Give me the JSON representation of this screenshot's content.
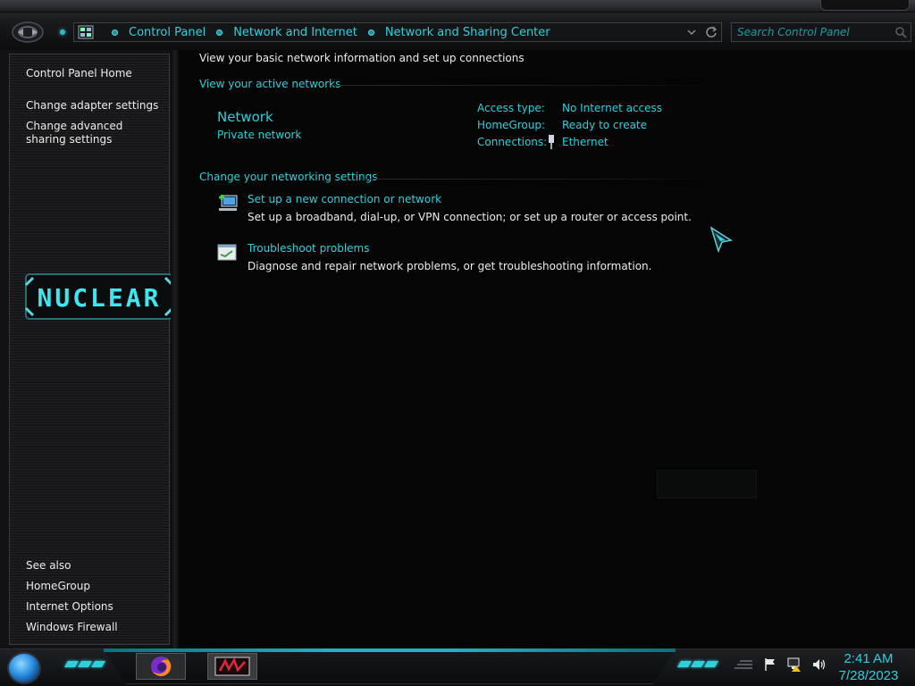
{
  "address_bar": {
    "crumbs": [
      "Control Panel",
      "Network and Internet",
      "Network and Sharing Center"
    ]
  },
  "search": {
    "placeholder": "Search Control Panel"
  },
  "sidebar": {
    "home": "Control Panel Home",
    "links": [
      "Change adapter settings",
      "Change advanced sharing settings"
    ],
    "logo_text": "NUCLEAR",
    "see_also_heading": "See also",
    "see_also": [
      "HomeGroup",
      "Internet Options",
      "Windows Firewall"
    ]
  },
  "main": {
    "title": "View your basic network information and set up connections",
    "active_networks_heading": "View your active networks",
    "network": {
      "name": "Network",
      "type": "Private network",
      "access_type_label": "Access type:",
      "access_type_value": "No Internet access",
      "homegroup_label": "HomeGroup:",
      "homegroup_value": "Ready to create",
      "connections_label": "Connections:",
      "connections_value": "Ethernet"
    },
    "settings_heading": "Change your networking settings",
    "tasks": [
      {
        "link": "Set up a new connection or network",
        "desc": "Set up a broadband, dial-up, or VPN connection; or set up a router or access point."
      },
      {
        "link": "Troubleshoot problems",
        "desc": "Diagnose and repair network problems, or get troubleshooting information."
      }
    ]
  },
  "taskbar": {
    "apps": [
      "firefox-icon",
      "media-app-icon"
    ],
    "clock_time": "2:41 AM",
    "clock_date": "7/28/2023"
  },
  "colors": {
    "accent": "#2fd0dc",
    "text": "#ececec",
    "background": "#050505"
  }
}
